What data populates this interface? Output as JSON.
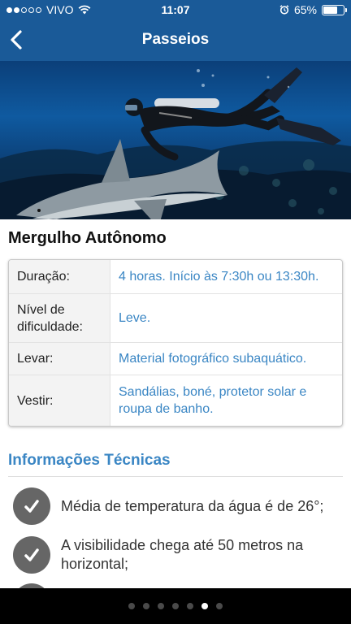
{
  "status_bar": {
    "carrier": "VIVO",
    "time": "11:07",
    "battery": "65%",
    "battery_level": 0.65,
    "signal_bars_filled": 2,
    "signal_bars_total": 5
  },
  "nav": {
    "title": "Passeios",
    "back_icon": "chevron-left-icon"
  },
  "hero": {
    "icon": "scuba-diver-shark-photo"
  },
  "content": {
    "title": "Mergulho Autônomo",
    "details": [
      {
        "label": "Duração:",
        "value": "4 horas. Início às 7:30h ou 13:30h."
      },
      {
        "label": "Nível de dificuldade:",
        "value": "Leve."
      },
      {
        "label": "Levar:",
        "value": "Material fotográfico subaquático."
      },
      {
        "label": "Vestir:",
        "value": "Sandálias, boné, protetor solar e roupa de banho."
      }
    ],
    "technical_title": "Informações Técnicas",
    "technical_items": [
      "Média de temperatura da água é de 26°;",
      "A visibilidade chega até 50 metros na horizontal;"
    ]
  },
  "pager": {
    "count": 7,
    "active_index": 5
  },
  "colors": {
    "header_bg": "#1a5a98",
    "accent": "#3a86c4",
    "check_circle": "#666666",
    "footer_bg": "#000000"
  }
}
